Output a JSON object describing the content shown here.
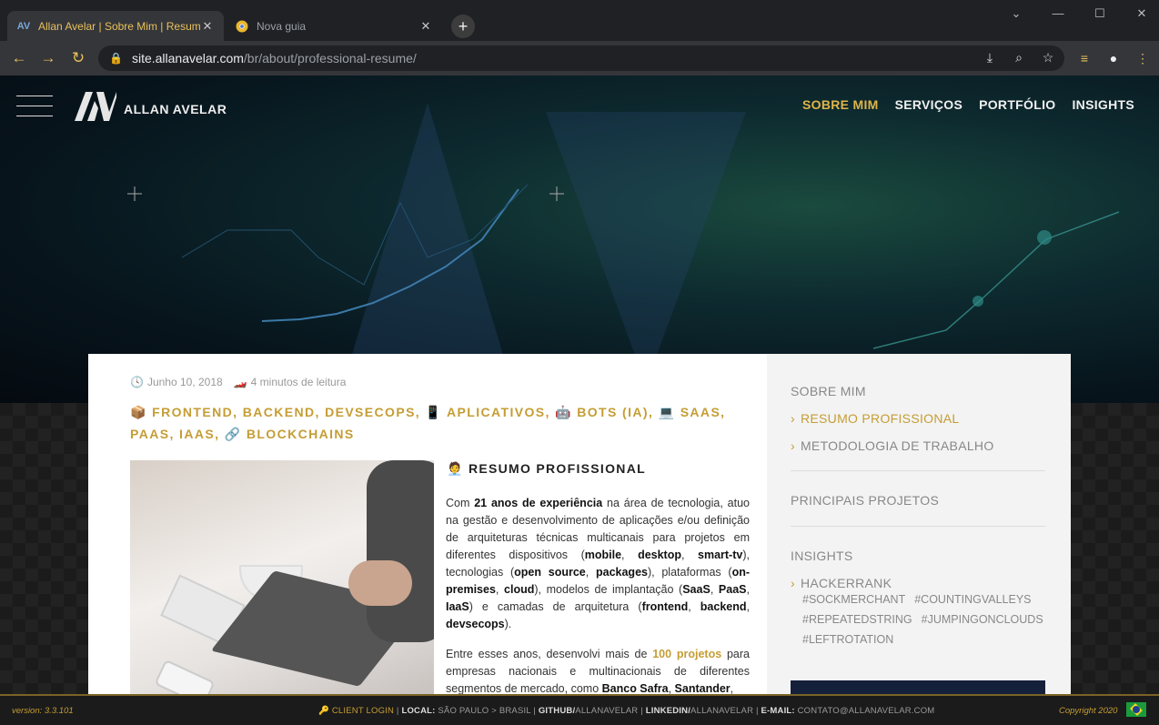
{
  "browser": {
    "tabs": [
      {
        "title": "Allan Avelar | Sobre Mim | Resum",
        "favicon": "av-logo-icon",
        "active": true
      },
      {
        "title": "Nova guia",
        "favicon": "chrome-icon",
        "active": false
      }
    ],
    "url_host": "site.allanavelar.com",
    "url_path": "/br/about/professional-resume/",
    "accent": "#e8c15a"
  },
  "site": {
    "brand": "ALLAN AVELAR",
    "menu": [
      "SOBRE MIM",
      "SERVIÇOS",
      "PORTFÓLIO",
      "INSIGHTS"
    ],
    "menu_active_index": 0,
    "accent": "#c59d34"
  },
  "article": {
    "date": "Junho 10, 2018",
    "read_time": "4 minutos de leitura",
    "categories": [
      {
        "emoji": "📦",
        "label": "FRONTEND, BACKEND, DEVSECOPS,"
      },
      {
        "emoji": "📱",
        "label": "APLICATIVOS,"
      },
      {
        "emoji": "🤖",
        "label": "BOTS (IA),"
      },
      {
        "emoji": "💻",
        "label": "SAAS,"
      },
      {
        "emoji": "",
        "label": "PAAS, IAAS,"
      },
      {
        "emoji": "🔗",
        "label": "BLOCKCHAINS"
      }
    ],
    "section_emoji": "🧑‍💼",
    "section_title": "RESUMO PROFISSIONAL",
    "p1_parts": [
      {
        "t": "Com ",
        "s": ""
      },
      {
        "t": "21 anos de experiência",
        "s": "b"
      },
      {
        "t": " na área de tecnologia, atuo na gestão e desenvolvimento de aplicações e/ou definição de arquiteturas técnicas multicanais para projetos em diferentes dispositivos (",
        "s": ""
      },
      {
        "t": "mobile",
        "s": "b"
      },
      {
        "t": ", ",
        "s": ""
      },
      {
        "t": "desktop",
        "s": "b"
      },
      {
        "t": ", ",
        "s": ""
      },
      {
        "t": "smart-tv",
        "s": "b"
      },
      {
        "t": "), tecnologias (",
        "s": ""
      },
      {
        "t": "open source",
        "s": "b"
      },
      {
        "t": ", ",
        "s": ""
      },
      {
        "t": "packages",
        "s": "b"
      },
      {
        "t": "), plataformas (",
        "s": ""
      },
      {
        "t": "on-premises",
        "s": "b"
      },
      {
        "t": ", ",
        "s": ""
      },
      {
        "t": "cloud",
        "s": "b"
      },
      {
        "t": "), modelos de implantação (",
        "s": ""
      },
      {
        "t": "SaaS",
        "s": "b"
      },
      {
        "t": ", ",
        "s": ""
      },
      {
        "t": "PaaS",
        "s": "b"
      },
      {
        "t": ", ",
        "s": ""
      },
      {
        "t": "IaaS",
        "s": "b"
      },
      {
        "t": ") e camadas de arquitetura (",
        "s": ""
      },
      {
        "t": "frontend",
        "s": "b"
      },
      {
        "t": ", ",
        "s": ""
      },
      {
        "t": "backend",
        "s": "b"
      },
      {
        "t": ", ",
        "s": ""
      },
      {
        "t": "devsecops",
        "s": "b"
      },
      {
        "t": ").",
        "s": ""
      }
    ],
    "p2_parts": [
      {
        "t": "Entre esses anos, desenvolvi mais de ",
        "s": ""
      },
      {
        "t": "100 projetos",
        "s": "gold"
      },
      {
        "t": " para empresas nacionais e multinacionais de diferentes segmentos de mercado, como ",
        "s": ""
      },
      {
        "t": "Banco Safra",
        "s": "b"
      },
      {
        "t": ", ",
        "s": ""
      },
      {
        "t": "Santander",
        "s": "b"
      },
      {
        "t": ",",
        "s": ""
      }
    ]
  },
  "sidebar": {
    "heading_about": "SOBRE MIM",
    "item_resume": "RESUMO PROFISSIONAL",
    "item_method": "METODOLOGIA DE TRABALHO",
    "heading_projects": "PRINCIPAIS PROJETOS",
    "heading_insights": "INSIGHTS",
    "item_hackerrank": "HACKERRANK",
    "tags": [
      "#SOCKMERCHANT",
      "#COUNTINGVALLEYS",
      "#REPEATEDSTRING",
      "#JUMPINGONCLOUDS",
      "#LEFTROTATION"
    ]
  },
  "footer": {
    "version": "version: 3.3.101",
    "client_login": "CLIENT LOGIN",
    "local_label": "LOCAL:",
    "local_value": "SÃO PAULO > BRASIL",
    "github_label": "GITHUB/",
    "github_value": "ALLANAVELAR",
    "linkedin_label": "LINKEDIN/",
    "linkedin_value": "ALLANAVELAR",
    "email_label": "E-MAIL:",
    "email_value": "CONTATO@ALLANAVELAR.COM",
    "copyright": "Copyright 2020"
  }
}
